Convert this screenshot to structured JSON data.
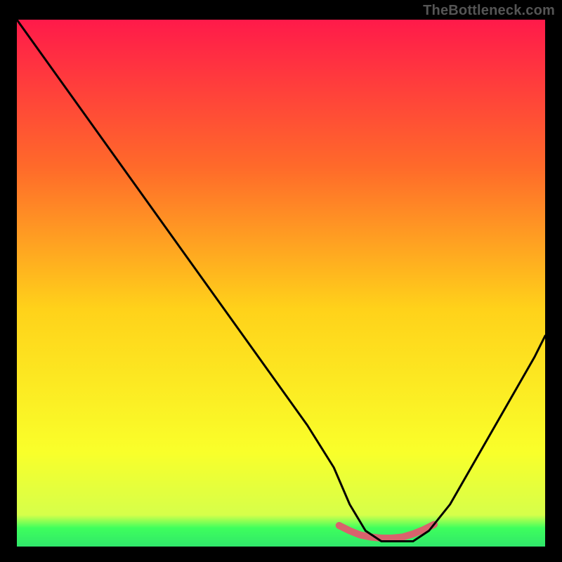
{
  "watermark": "TheBottleneck.com",
  "chart_data": {
    "type": "line",
    "title": "",
    "xlabel": "",
    "ylabel": "",
    "xlim": [
      0,
      100
    ],
    "ylim": [
      0,
      100
    ],
    "background_gradient": {
      "top": "#ff1a4a",
      "mid_upper": "#ff6a2a",
      "middle": "#ffd21a",
      "mid_lower": "#f9ff2a",
      "bottom_band": "#3eff5d",
      "very_bottom": "#30e66a"
    },
    "series": [
      {
        "name": "main-curve",
        "color": "#000000",
        "x": [
          0,
          5,
          10,
          15,
          20,
          25,
          30,
          35,
          40,
          45,
          50,
          55,
          60,
          63,
          66,
          69,
          72,
          75,
          78,
          82,
          86,
          90,
          94,
          98,
          100
        ],
        "y": [
          100,
          93,
          86,
          79,
          72,
          65,
          58,
          51,
          44,
          37,
          30,
          23,
          15,
          8,
          3,
          1,
          1,
          1,
          3,
          8,
          15,
          22,
          29,
          36,
          40
        ]
      },
      {
        "name": "valley-band",
        "color": "#d9626d",
        "x": [
          61,
          63,
          65,
          67,
          69,
          71,
          73,
          75,
          77,
          79
        ],
        "y": [
          4.0,
          3.0,
          2.2,
          1.8,
          1.6,
          1.6,
          1.8,
          2.4,
          3.2,
          4.2
        ]
      }
    ],
    "grid": false,
    "legend": null
  }
}
